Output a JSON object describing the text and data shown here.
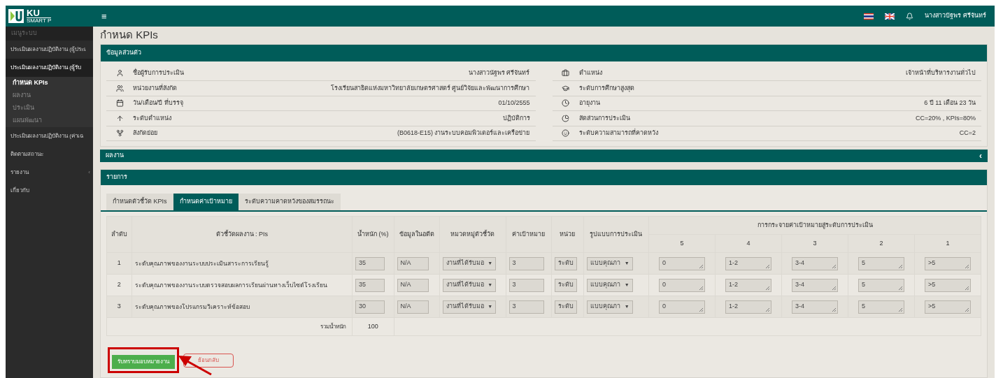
{
  "header": {
    "logo_main": "KU",
    "logo_sub": "SMART P",
    "menu_glyph": "≡",
    "user": "นางสาวปัฐพร ศรีจันทร์"
  },
  "sidebar": {
    "heading": "เมนูระบบ",
    "items": [
      {
        "label": "ประเมินผลงานปฏิบัติงาน (ผู้ประเ",
        "expanded": false
      },
      {
        "label": "ประเมินผลงานปฏิบัติงาน (ผู้รับ",
        "expanded": true,
        "children": [
          {
            "label": "กำหนด KPIs",
            "selected": true
          },
          {
            "label": "ผลงาน",
            "selected": false
          },
          {
            "label": "ประเมิน",
            "selected": false
          },
          {
            "label": "แผนพัฒนา",
            "selected": false
          }
        ]
      },
      {
        "label": "ประเมินผลงานปฏิบัติงาน (ค่าเฉ",
        "expanded": false
      },
      {
        "label": "ติดตามสถานะ",
        "expanded": false
      },
      {
        "label": "รายงาน",
        "expanded": false,
        "caret": "‹"
      },
      {
        "label": "เกี่ยวกับ",
        "expanded": false
      }
    ]
  },
  "page_title": "กำหนด KPIs",
  "personal": {
    "title": "ข้อมูลส่วนตัว",
    "left": [
      {
        "kind": "user",
        "label": "ชื่อผู้รับการประเมิน",
        "value": "นางสาวนัฐพร ศรีจันทร์"
      },
      {
        "kind": "users",
        "label": "หน่วยงานที่สังกัด",
        "value": "โรงเรียนสาธิตแห่งมหาวิทยาลัยเกษตรศาสตร์ ศูนย์วิจัยและพัฒนาการศึกษา"
      },
      {
        "kind": "calendar",
        "label": "วัน/เดือน/ปี ที่บรรจุ",
        "value": "01/10/2555"
      },
      {
        "kind": "level",
        "label": "ระดับตำแหน่ง",
        "value": "ปฏิบัติการ"
      },
      {
        "kind": "fork",
        "label": "สังกัดย่อย",
        "value": "(B0618-E15) งานระบบคอมพิวเตอร์และเครือข่าย"
      }
    ],
    "right": [
      {
        "kind": "briefcase",
        "label": "ตำแหน่ง",
        "value": "เจ้าหน้าที่บริหารงานทั่วไป"
      },
      {
        "kind": "cap",
        "label": "ระดับการศึกษาสูงสุด"
      },
      {
        "kind": "clock",
        "label": "อายุงาน",
        "value": "6 ปี 11 เดือน 23 วัน"
      },
      {
        "kind": "pie",
        "label": "สัดส่วนการประเมิน",
        "value": "CC=20% , KPIs=80%"
      },
      {
        "kind": "smile",
        "label": "ระดับความสามารถที่คาดหวัง",
        "value": "CC=2"
      }
    ]
  },
  "results": {
    "title": "ผลงาน",
    "collapse_glyph": "‹"
  },
  "list": {
    "title": "รายการ",
    "tabs": [
      {
        "label": "กำหนดตัวชี้วัด KPIs",
        "selected": false
      },
      {
        "label": "กำหนดค่าเป้าหมาย",
        "selected": true
      },
      {
        "label": "ระดับความคาดหวังของสมรรถนะ",
        "selected": false
      }
    ],
    "columns": [
      "ลำดับ",
      "ตัวชี้วัดผลงาน : PIs",
      "น้ำหนัก (%)",
      "ข้อมูลในอดีต",
      "หมวดหมู่ตัวชี้วัด",
      "ค่าเป้าหมาย",
      "หน่วย",
      "รูปแบบการประเมิน"
    ],
    "distribution_title": "การกระจายค่าเป้าหมายสู่ระดับการประเมิน",
    "levels": [
      "5",
      "4",
      "3",
      "2",
      "1"
    ],
    "dropdown_glyph": "▼",
    "rows": [
      {
        "no": "1",
        "name": "ระดับคุณภาพของงานระบบประเมินสาระการเรียนรู้",
        "weight": "35",
        "history": "N/A",
        "category": "งานที่ได้รับมอ",
        "target": "3",
        "unit": "ระดับ",
        "method": "แบบคุณภา",
        "targets": [
          "0",
          "1-2",
          "3-4",
          "5",
          ">5"
        ]
      },
      {
        "no": "2",
        "name": "ระดับคุณภาพของงานระบบตรวจสอบผลการเรียนผ่านทางเว็บไซต์โรงเรียน",
        "weight": "35",
        "history": "N/A",
        "category": "งานที่ได้รับมอ",
        "target": "3",
        "unit": "ระดับ",
        "method": "แบบคุณภา",
        "targets": [
          "0",
          "1-2",
          "3-4",
          "5",
          ">5"
        ]
      },
      {
        "no": "3",
        "name": "ระดับคุณภาพของโปรแกรมวิเคราะห์ข้อสอบ",
        "weight": "30",
        "history": "N/A",
        "category": "งานที่ได้รับมอ",
        "target": "3",
        "unit": "ระดับ",
        "method": "แบบคุณภา",
        "targets": [
          "0",
          "1-2",
          "3-4",
          "5",
          ">5"
        ]
      }
    ],
    "total_label": "รวมน้ำหนัก",
    "total": "100",
    "accept_button": "รับทราบมอบหมายงาน",
    "back_button": "ย้อนกลับ"
  }
}
